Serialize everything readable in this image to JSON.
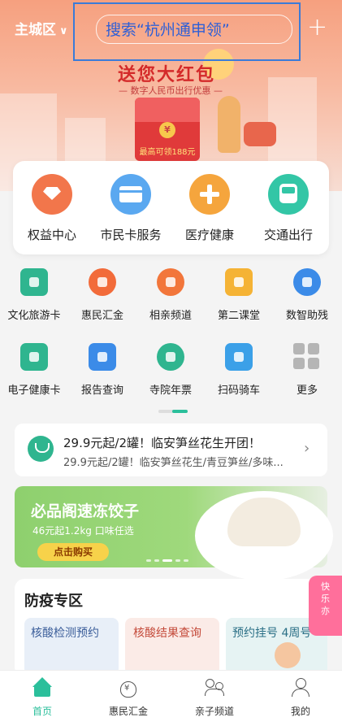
{
  "header": {
    "city": "主城区",
    "search_text": "搜索“杭州通申领”",
    "add_symbol": "+"
  },
  "banner": {
    "title": "送您大红包",
    "subtitle": "— 数字人民币出行优惠 —",
    "max_text": "最高可领188元",
    "coin_symbol": "¥"
  },
  "quick_services": [
    {
      "label": "权益中心",
      "icon": "gem-icon",
      "color": "#f2764b"
    },
    {
      "label": "市民卡服务",
      "icon": "card-icon",
      "color": "#5aa8f0"
    },
    {
      "label": "医疗健康",
      "icon": "medical-cross-icon",
      "color": "#f5a53d"
    },
    {
      "label": "交通出行",
      "icon": "bus-icon",
      "color": "#33c6a6"
    }
  ],
  "grid_services": [
    {
      "label": "文化旅游卡",
      "icon": "travel-card-icon",
      "color": "#2fb58f"
    },
    {
      "label": "惠民汇金",
      "icon": "money-bag-icon",
      "color": "#f26b3a"
    },
    {
      "label": "相亲频道",
      "icon": "couple-icon",
      "color": "#f2763b"
    },
    {
      "label": "第二课堂",
      "icon": "check-flag-icon",
      "color": "#f5b335"
    },
    {
      "label": "数智助残",
      "icon": "flower-icon",
      "color": "#3b8be8"
    },
    {
      "label": "电子健康卡",
      "icon": "heartbeat-icon",
      "color": "#2fb58f"
    },
    {
      "label": "报告查询",
      "icon": "report-icon",
      "color": "#3b8be8"
    },
    {
      "label": "寺院年票",
      "icon": "temple-icon",
      "color": "#2fb58f"
    },
    {
      "label": "扫码骑车",
      "icon": "bike-scan-icon",
      "color": "#3ba0e8"
    },
    {
      "label": "更多",
      "icon": "more-grid-icon",
      "color": "#b5b5b5"
    }
  ],
  "promo": {
    "title": "29.9元起/2罐！临安笋丝花生开团！",
    "description": "29.9元起/2罐！临安笋丝花生/青豆笋丝/多味..."
  },
  "ad": {
    "title": "必品阁速冻饺子",
    "subtitle": "46元起1.2kg 口味任选",
    "button": "点击购买"
  },
  "epidemic": {
    "title": "防疫专区",
    "cards": [
      {
        "label": "核酸检测预约",
        "color": "#3b5e9a",
        "bg": "#e8eff8"
      },
      {
        "label": "核酸结果查询",
        "color": "#c44a3a",
        "bg": "#fbebe7"
      },
      {
        "label": "预约挂号 4周号",
        "color": "#2a6f86",
        "bg": "#e6f3f3"
      }
    ],
    "side_badge": "快乐亦"
  },
  "bottom_nav": [
    {
      "label": "首页",
      "icon": "home-icon",
      "active": true
    },
    {
      "label": "惠民汇金",
      "icon": "money-bag-icon",
      "active": false
    },
    {
      "label": "亲子频道",
      "icon": "family-icon",
      "active": false
    },
    {
      "label": "我的",
      "icon": "profile-icon",
      "active": false
    }
  ],
  "colors": {
    "accent": "#2bbf9b",
    "search_highlight": "#3b7bd8"
  }
}
